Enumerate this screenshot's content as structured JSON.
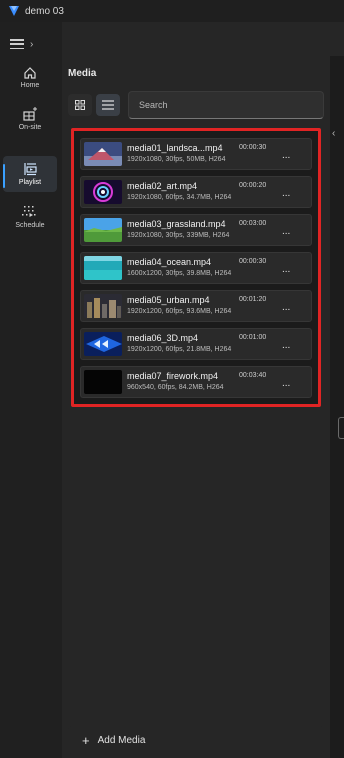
{
  "window": {
    "title": "demo 03"
  },
  "nav": {
    "items": [
      {
        "label": "Home",
        "icon": "home-icon"
      },
      {
        "label": "On-site",
        "icon": "onsite-icon"
      },
      {
        "label": "Playlist",
        "icon": "playlist-icon",
        "active": true
      },
      {
        "label": "Schedule",
        "icon": "schedule-icon"
      }
    ]
  },
  "media_panel": {
    "title": "Media",
    "search_placeholder": "Search",
    "add_label": "Add Media",
    "items": [
      {
        "name": "media01_landsca...mp4",
        "duration": "00:00:30",
        "meta": "1920x1080, 30fps, 50MB, H264",
        "more": "..."
      },
      {
        "name": "media02_art.mp4",
        "duration": "00:00:20",
        "meta": "1920x1080, 60fps, 34.7MB, H264",
        "more": "..."
      },
      {
        "name": "media03_grassland.mp4",
        "duration": "00:03:00",
        "meta": "1920x1080, 30fps, 339MB, H264",
        "more": "..."
      },
      {
        "name": "media04_ocean.mp4",
        "duration": "00:00:30",
        "meta": "1600x1200, 30fps, 39.8MB, H264",
        "more": "..."
      },
      {
        "name": "media05_urban.mp4",
        "duration": "00:01:20",
        "meta": "1920x1200, 60fps, 93.6MB, H264",
        "more": "..."
      },
      {
        "name": "media06_3D.mp4",
        "duration": "00:01:00",
        "meta": "1920x1200, 60fps, 21.8MB, H264",
        "more": "..."
      },
      {
        "name": "media07_firework.mp4",
        "duration": "00:03:40",
        "meta": "960x540, 60fps, 84.2MB, H264",
        "more": "..."
      }
    ]
  },
  "colors": {
    "accent": "#3aa0ff",
    "highlight_border": "#e02424"
  }
}
